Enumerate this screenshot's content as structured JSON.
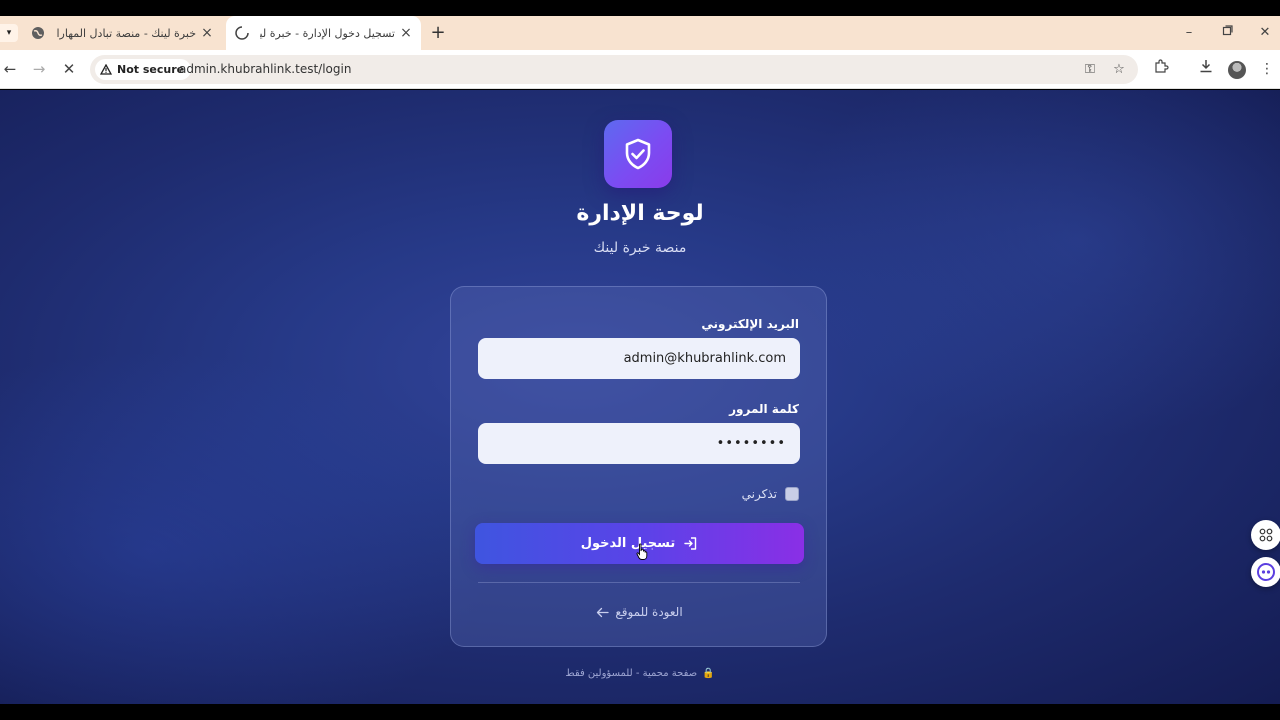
{
  "browser": {
    "tabs": [
      {
        "title": "خبرة لينك - منصة تبادل المهارات",
        "active": false
      },
      {
        "title": "تسجيل دخول الإدارة - خبرة لينك",
        "active": true
      }
    ],
    "security_label": "Not secure",
    "url": "admin.khubrahlink.test/login"
  },
  "header": {
    "title": "لوحة الإدارة",
    "subtitle": "منصة خبرة لينك"
  },
  "form": {
    "email_label": "البريد الإلكتروني",
    "email_value": "admin@khubrahlink.com",
    "password_label": "كلمة المرور",
    "password_value": "••••••••",
    "remember_label": "تذكرني",
    "remember_checked": false,
    "submit_label": "تسجيل الدخول",
    "back_label": "العودة للموقع"
  },
  "footer": {
    "note": "صفحة محمية - للمسؤولين فقط"
  },
  "colors": {
    "accent_start": "#3f55e0",
    "accent_end": "#8a2fe6",
    "background": "#263987"
  }
}
